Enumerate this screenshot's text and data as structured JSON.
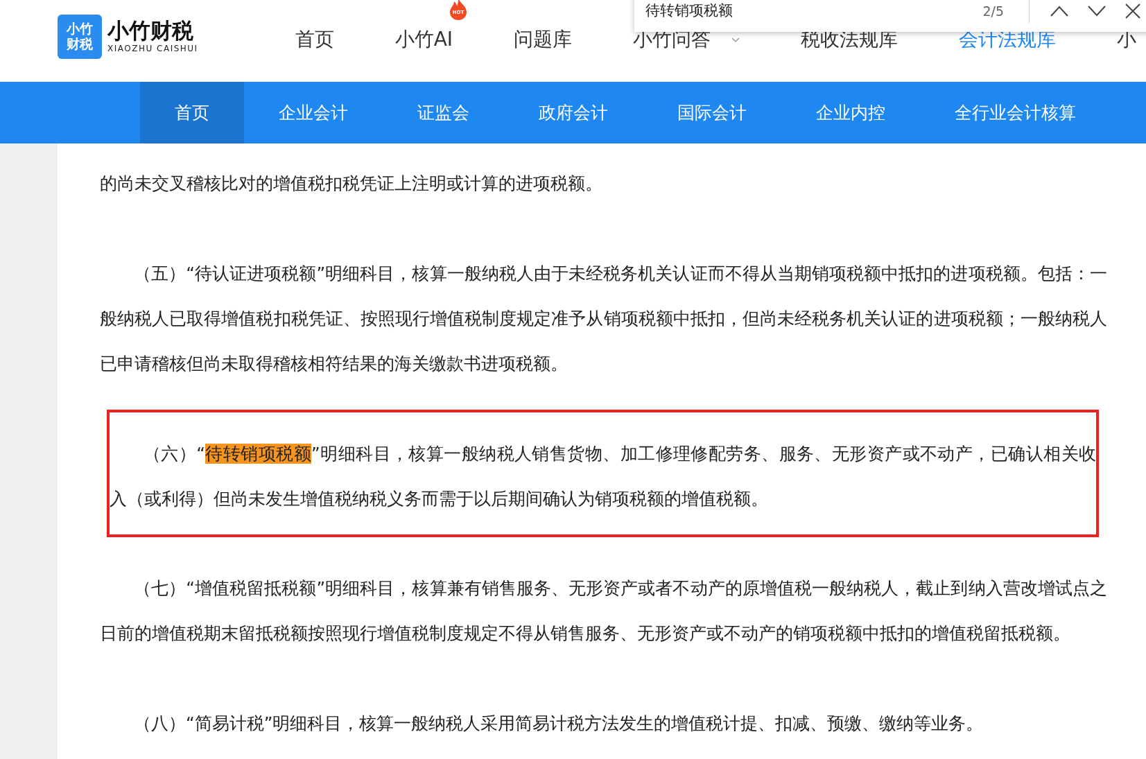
{
  "logo": {
    "mark": [
      "小竹",
      "财税"
    ],
    "name": "小竹财税",
    "subtitle": "XIAOZHU CAISHUI"
  },
  "top_nav": [
    {
      "label": "首页",
      "selected": false
    },
    {
      "label": "小竹AI",
      "selected": false,
      "badge": "HOT"
    },
    {
      "label": "问题库",
      "selected": false
    },
    {
      "label": "小竹问答",
      "selected": false,
      "dropdown": true
    },
    {
      "label": "税收法规库",
      "selected": false
    },
    {
      "label": "会计法规库",
      "selected": true
    },
    {
      "label": "小",
      "selected": false
    }
  ],
  "find_bar": {
    "query": "待转销项税额",
    "count": "2/5"
  },
  "sub_nav": [
    {
      "label": "首页",
      "selected": true
    },
    {
      "label": "企业会计",
      "selected": false
    },
    {
      "label": "证监会",
      "selected": false
    },
    {
      "label": "政府会计",
      "selected": false
    },
    {
      "label": "国际会计",
      "selected": false
    },
    {
      "label": "企业内控",
      "selected": false
    },
    {
      "label": "全行业会计核算",
      "selected": false
    }
  ],
  "paragraphs": [
    {
      "kind": "continuation",
      "text": "的尚未交叉稽核比对的增值税扣税凭证上注明或计算的进项税额。"
    },
    {
      "kind": "plain",
      "text": "（五）“待认证进项税额”明细科目，核算一般纳税人由于未经税务机关认证而不得从当期销项税额中抵扣的进项税额。包括：一般纳税人已取得增值税扣税凭证、按照现行增值税制度规定准予从销项税额中抵扣，但尚未经税务机关认证的进项税额；一般纳税人已申请稽核但尚未取得稽核相符结果的海关缴款书进项税额。"
    },
    {
      "kind": "boxed",
      "before": "（六）“",
      "highlight": "待转销项税额",
      "after": "”明细科目，核算一般纳税人销售货物、加工修理修配劳务、服务、无形资产或不动产，已确认相关收入（或利得）但尚未发生增值税纳税义务而需于以后期间确认为销项税额的增值税额。"
    },
    {
      "kind": "plain",
      "text": "（七）“增值税留抵税额”明细科目，核算兼有销售服务、无形资产或者不动产的原增值税一般纳税人，截止到纳入营改增试点之日前的增值税期末留抵税额按照现行增值税制度规定不得从销售服务、无形资产或不动产的销项税额中抵扣的增值税留抵税额。"
    },
    {
      "kind": "plain",
      "text": "（八）“简易计税”明细科目，核算一般纳税人采用简易计税方法发生的增值税计提、扣减、预缴、缴纳等业务。"
    }
  ]
}
